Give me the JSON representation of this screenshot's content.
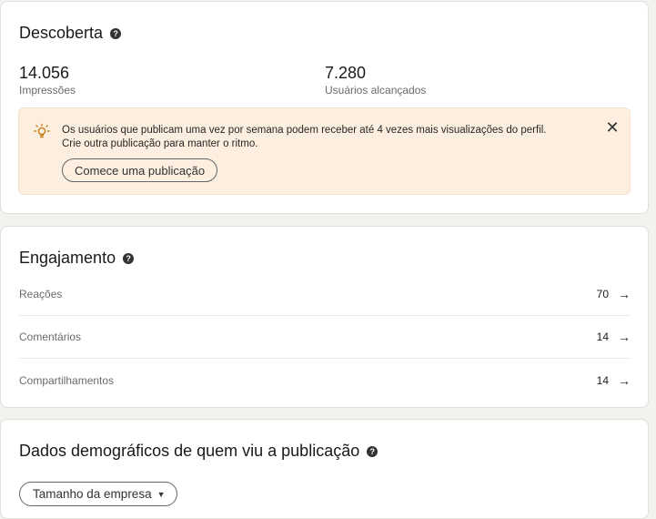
{
  "discovery": {
    "title": "Descoberta",
    "help_icon": "help-icon",
    "impressions_value": "14.056",
    "impressions_label": "Impressões",
    "reach_value": "7.280",
    "reach_label": "Usuários alcançados",
    "tip": {
      "icon": "lightbulb-icon",
      "line1": "Os usuários que publicam uma vez por semana podem receber até 4 vezes mais visualizações do perfil.",
      "line2": "Crie outra publicação para manter o ritmo.",
      "button": "Comece uma publicação",
      "close_icon": "close-icon",
      "close_glyph": "✕"
    }
  },
  "engagement": {
    "title": "Engajamento",
    "rows": [
      {
        "label": "Reações",
        "count": "70",
        "arrow": "→"
      },
      {
        "label": "Comentários",
        "count": "14",
        "arrow": "→"
      },
      {
        "label": "Compartilhamentos",
        "count": "14",
        "arrow": "→"
      }
    ]
  },
  "demographics": {
    "title": "Dados demográficos de quem viu a publicação",
    "dropdown_value": "Tamanho da empresa",
    "caret": "▼"
  },
  "colors": {
    "tip_background": "#fcefe0",
    "bulb": "#c37d16",
    "page_background": "#f4f2ee"
  }
}
